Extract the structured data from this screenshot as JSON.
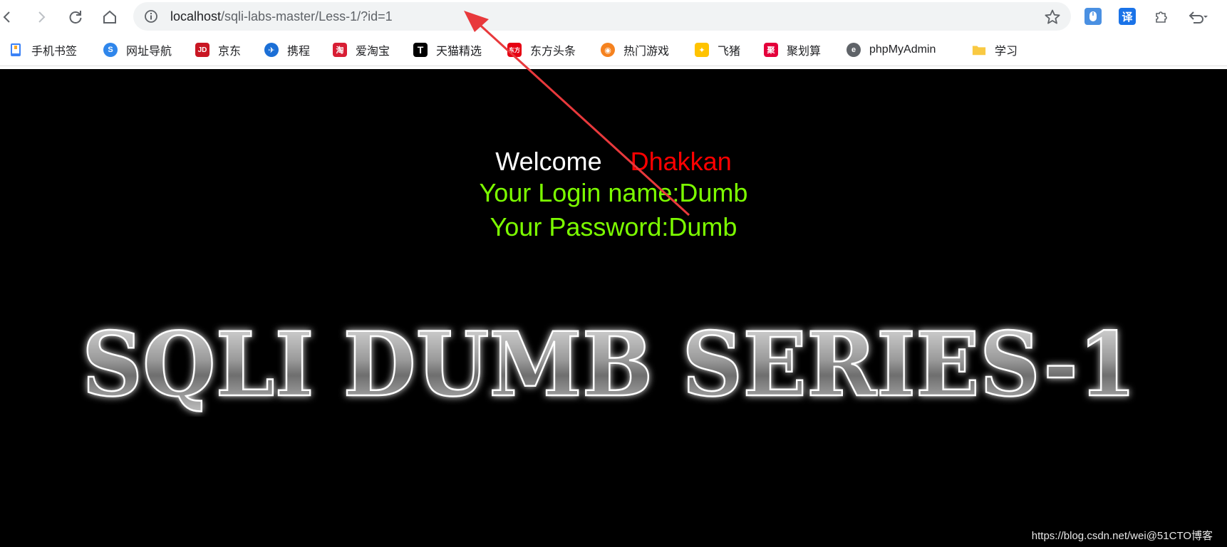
{
  "browser": {
    "url_host": "localhost",
    "url_path": "/sqli-labs-master/Less-1/?id=1",
    "extensions": [
      {
        "label": "",
        "icon": "mouse-extension-icon",
        "color": "#4a90e2"
      },
      {
        "label": "译",
        "icon": "translate-icon",
        "color": "#1a73e8"
      },
      {
        "label": "",
        "icon": "puzzle-icon",
        "color": "#5f6368"
      }
    ]
  },
  "bookmarks": [
    {
      "label": "手机书签",
      "icon": "mobile-bookmark-icon",
      "color": "#3b82f6",
      "glyph": ""
    },
    {
      "label": "网址导航",
      "icon": "nav-icon",
      "color": "#2f86eb",
      "glyph": "S"
    },
    {
      "label": "京东",
      "icon": "jd-icon",
      "color": "#c91623",
      "glyph": "JD"
    },
    {
      "label": "携程",
      "icon": "ctrip-icon",
      "color": "#1b6fd6",
      "glyph": "✈"
    },
    {
      "label": "爱淘宝",
      "icon": "taobao-icon",
      "color": "#d81e34",
      "glyph": "淘"
    },
    {
      "label": "天猫精选",
      "icon": "tmall-icon",
      "color": "#000000",
      "glyph": "T"
    },
    {
      "label": "东方头条",
      "icon": "dftt-icon",
      "color": "#e60012",
      "glyph": "东方"
    },
    {
      "label": "热门游戏",
      "icon": "game-icon",
      "color": "#f5821f",
      "glyph": "◉"
    },
    {
      "label": "飞猪",
      "icon": "fliggy-icon",
      "color": "#ffc300",
      "glyph": "✦"
    },
    {
      "label": "聚划算",
      "icon": "juhuasuan-icon",
      "color": "#e4003b",
      "glyph": "聚"
    },
    {
      "label": "phpMyAdmin",
      "icon": "phpmyadmin-icon",
      "color": "#5f6368",
      "glyph": "e"
    },
    {
      "label": "学习",
      "icon": "folder-icon",
      "color": "#f9c942",
      "glyph": ""
    }
  ],
  "content": {
    "welcome": "Welcome",
    "name": "Dhakkan",
    "login_line": "Your Login name:Dumb",
    "password_line": "Your Password:Dumb",
    "banner": "SQLI DUMB SERIES-1",
    "watermark": "https://blog.csdn.net/wei@51CTO博客"
  },
  "colors": {
    "page_bg": "#000000",
    "welcome": "#ffffff",
    "name": "#ff0000",
    "green_text": "#7cfc00",
    "annotation_arrow": "#e8393c"
  }
}
